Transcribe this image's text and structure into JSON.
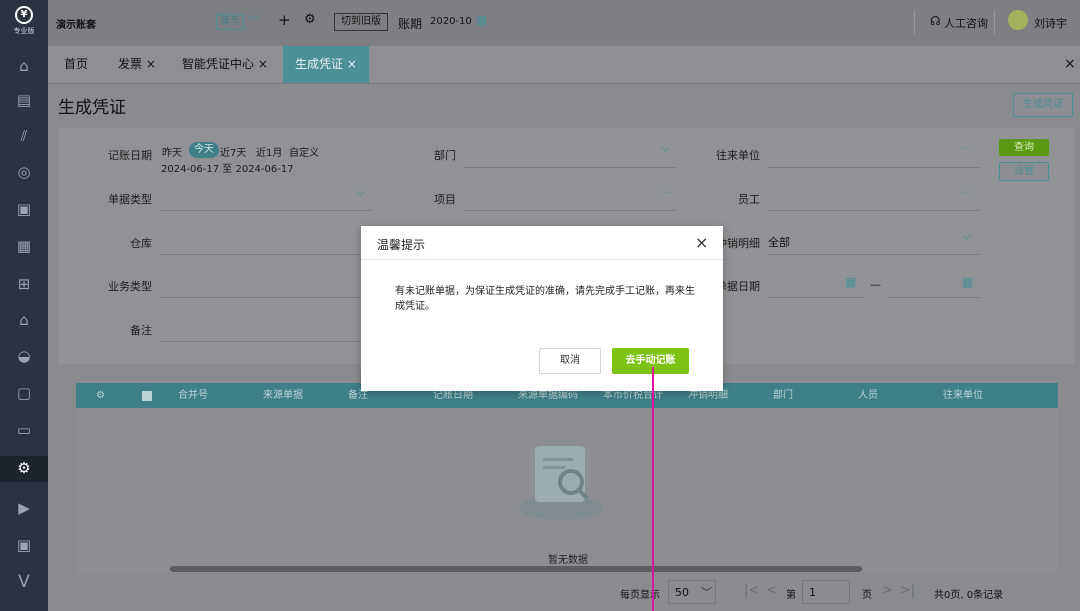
{
  "sidebar": {
    "logo_text": "专业版",
    "icons": [
      "home-icon",
      "invoice-icon",
      "chart-icon",
      "money-bag-icon",
      "receipt-icon",
      "report-icon",
      "store-icon",
      "building-icon",
      "wallet-icon",
      "document-icon",
      "inbox-icon",
      "settings-icon",
      "media-icon",
      "tv-icon",
      "v-logo-icon"
    ]
  },
  "topbar": {
    "account_set": "演示账套",
    "demo_badge": "演示",
    "switch_old": "切到旧版",
    "period_label": "账期",
    "period_value": "2020-10",
    "support": "人工咨询",
    "user_name": "刘诗宇"
  },
  "tabs": [
    {
      "label": "首页"
    },
    {
      "label": "发票 ×"
    },
    {
      "label": "智能凭证中心 ×"
    },
    {
      "label": "生成凭证 ×"
    }
  ],
  "tabs_close": "×",
  "page": {
    "title": "生成凭证",
    "generate_btn": "生成凭证"
  },
  "filters": {
    "date_label": "记账日期",
    "quick": [
      "昨天",
      "今天",
      "近7天",
      "近1月",
      "自定义"
    ],
    "date_range": "2024-06-17 至 2024-06-17",
    "dept_label": "部门",
    "partner_label": "往来单位",
    "doc_type_label": "单据类型",
    "project_label": "项目",
    "employee_label": "员工",
    "warehouse_label": "仓库",
    "offset_label": "冲销明细",
    "offset_value": "全部",
    "biz_type_label": "业务类型",
    "doc_date_label": "单据日期",
    "doc_date_sep": "—",
    "remark_label": "备注",
    "query_btn": "查询",
    "settings_btn": "设置",
    "dots": "···"
  },
  "table": {
    "headers": [
      "合并号",
      "来源单据",
      "备注",
      "记账日期",
      "来源单据编码",
      "本币价税合计",
      "冲销明细",
      "部门",
      "人员",
      "往来单位"
    ],
    "empty_text": "暂无数据"
  },
  "pagination": {
    "per_page_label": "每页显示",
    "per_page": "50",
    "page_prefix": "第",
    "page_num": "1",
    "page_suffix": "页",
    "total": "共0页, 0条记录"
  },
  "modal": {
    "title": "温馨提示",
    "close": "×",
    "message": "有未记账单据，为保证生成凭证的准确，请先完成手工记账，再来生成凭证。",
    "cancel": "取消",
    "confirm": "去手动记账"
  },
  "colors": {
    "accent": "#4d8f97",
    "confirm_green": "#7ec215",
    "pointer": "#e0139e"
  }
}
